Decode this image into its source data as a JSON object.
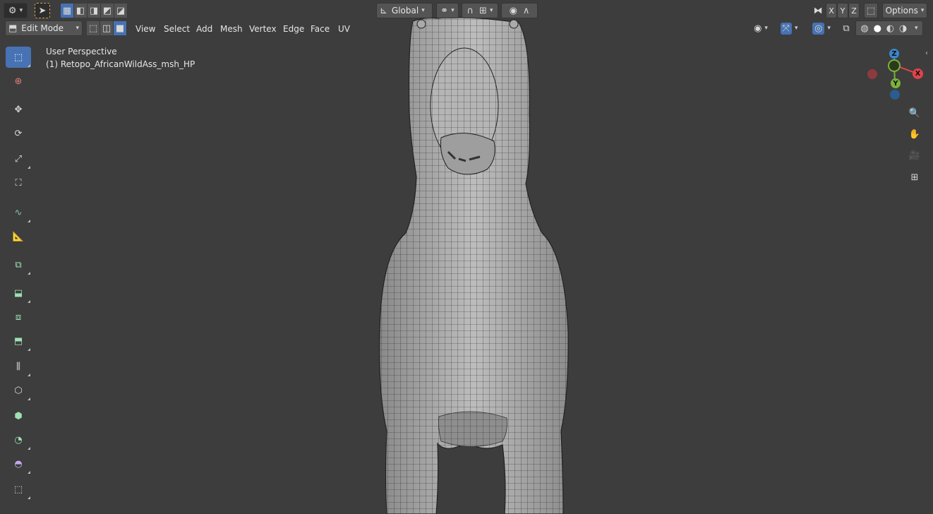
{
  "header": {
    "orientation": {
      "value": "Global"
    },
    "mode": {
      "value": "Edit Mode"
    },
    "menus": [
      "View",
      "Select",
      "Add",
      "Mesh",
      "Vertex",
      "Edge",
      "Face",
      "UV"
    ],
    "axis_buttons": [
      "X",
      "Y",
      "Z"
    ],
    "options_label": "Options"
  },
  "viewport": {
    "view_name": "User Perspective",
    "object_name": "(1) Retopo_AfricanWildAss_msh_HP"
  },
  "gizmo": {
    "z": "Z",
    "y": "Y",
    "x": "X"
  },
  "colors": {
    "active_blue": "#4772b3",
    "axis_x": "#e2434a",
    "axis_y": "#7ab33a",
    "axis_z": "#3a86cf",
    "background": "#3d3d3d"
  },
  "toolbar_tools": [
    "select-box",
    "cursor",
    "move",
    "rotate",
    "scale",
    "transform",
    "annotate",
    "measure",
    "add-cube",
    "extrude-region",
    "inset-faces",
    "bevel",
    "loop-cut",
    "knife",
    "poly-build",
    "spin",
    "smooth",
    "edge-slide"
  ]
}
